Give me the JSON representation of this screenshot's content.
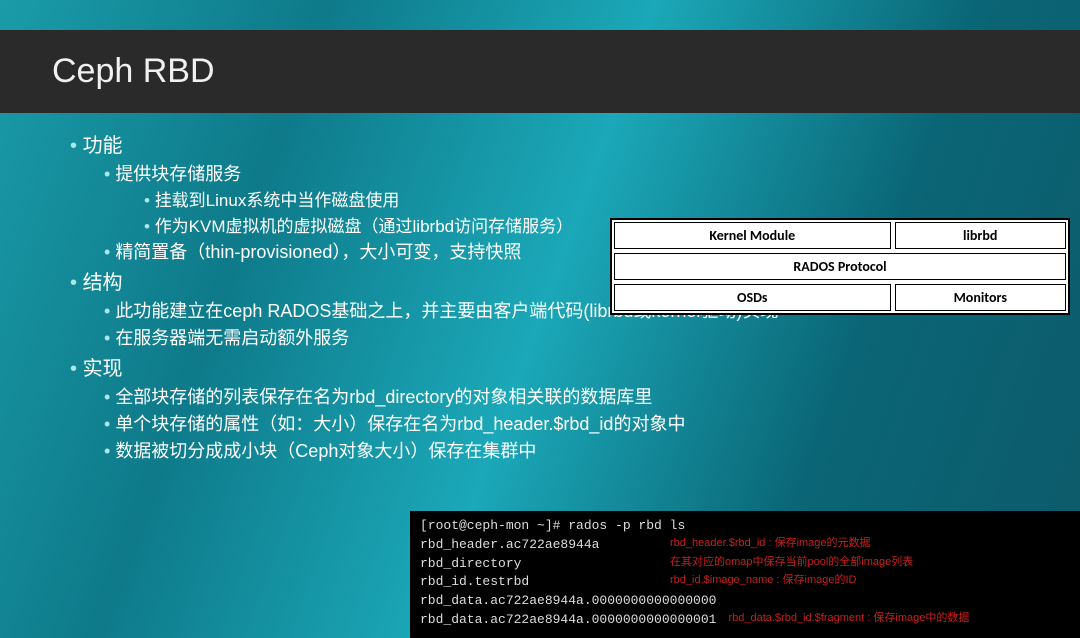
{
  "title": "Ceph RBD",
  "bullets": {
    "s1": "功能",
    "s1_1": "提供块存储服务",
    "s1_1_1": "挂载到Linux系统中当作磁盘使用",
    "s1_1_2": "作为KVM虚拟机的虚拟磁盘（通过librbd访问存储服务）",
    "s1_2": "精简置备（thin-provisioned），大小可变，支持快照",
    "s2": "结构",
    "s2_1": "此功能建立在ceph RADOS基础之上，并主要由客户端代码(librbd或kernel驱动)实现",
    "s2_2": "在服务器端无需启动额外服务",
    "s3": "实现",
    "s3_1": "全部块存储的列表保存在名为rbd_directory的对象相关联的数据库里",
    "s3_2": "单个块存储的属性（如：大小）保存在名为rbd_header.$rbd_id的对象中",
    "s3_3": "数据被切分成成小块（Ceph对象大小）保存在集群中"
  },
  "diagram": {
    "top_left": "Kernel Module",
    "top_right": "librbd",
    "middle": "RADOS Protocol",
    "bottom_left": "OSDs",
    "bottom_right": "Monitors"
  },
  "terminal": {
    "prompt": "[root@ceph-mon ~]# rados -p rbd ls",
    "l1": "rbd_header.ac722ae8944a",
    "n1": "rbd_header.$rbd_id : 保存image的元数据",
    "l2": "rbd_directory",
    "n2": "在其对应的omap中保存当前pool的全部image列表",
    "l3": "rbd_id.testrbd",
    "n3": "rbd_id.$image_name : 保存image的ID",
    "l4": "rbd_data.ac722ae8944a.0000000000000000",
    "l5": "rbd_data.ac722ae8944a.0000000000000001",
    "n5": "rbd_data.$rbd_id.$fragment : 保存image中的数据"
  }
}
